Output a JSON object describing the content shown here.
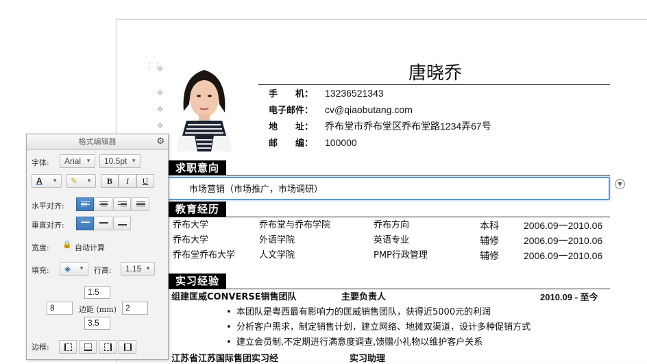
{
  "resume": {
    "name": "唐晓乔",
    "contact": [
      {
        "label": "手　　机：",
        "value": "13236521343"
      },
      {
        "label": "电子邮件：",
        "value": "cv@qiaobutang.com"
      },
      {
        "label": "地　　址：",
        "value": "乔布堂市乔布堂区乔布堂路1234弄67号"
      },
      {
        "label": "邮　　编：",
        "value": "100000"
      }
    ],
    "sections": {
      "intent": {
        "title": "求职意向",
        "text": "市场营销（市场推广，市场调研）"
      },
      "education": {
        "title": "教育经历",
        "rows": [
          [
            "乔布大学",
            "乔布堂与乔布学院",
            "乔布方向",
            "本科",
            "2006.09一2010.06"
          ],
          [
            "乔布大学",
            "外语学院",
            "英语专业",
            "辅修",
            "2006.09一2010.06"
          ],
          [
            "乔布堂乔布大学",
            "人文学院",
            "PMP行政管理",
            "辅修",
            "2006.09一2010.06"
          ]
        ]
      },
      "internship": {
        "title": "实习经验",
        "org": "组建匡威CONVERSE销售团队",
        "role": "主要负责人",
        "period": "2010.09 - 至今",
        "bullets": [
          "本团队是粤西最有影响力的匡威销售团队，获得近5000元的利润",
          "分析客户需求，制定销售计划，建立网络、地摊双渠道，设计多种促销方式",
          "建立会员制,不定期进行满意度调查,馈赠小礼物以维护客户关系"
        ],
        "next_row_partial": "江苏省江苏国际售团实习经　　　　　　　　实习助理"
      }
    }
  },
  "format_editor": {
    "title": "格式编辑器",
    "font_label": "字体:",
    "font_family": "Arial",
    "font_size": "10.5pt",
    "bold_label": "B",
    "italic_label": "I",
    "underline_label": "U",
    "font_color_label": "A",
    "halign_label": "水平对齐:",
    "valign_label": "垂直对齐:",
    "width_label": "宽度:",
    "width_value": "自动计算",
    "fill_label": "填充:",
    "line_height_label": "行高:",
    "line_height_value": "1.15",
    "margin_label": "边距 (mm)",
    "margin_top": "1.5",
    "margin_left": "8",
    "margin_right": "2",
    "margin_bottom": "3.5",
    "border_label": "边框:",
    "halign_selected": "left",
    "valign_selected": "top"
  },
  "colors": {
    "accent_blue": "#3e78b7",
    "focus_border": "#5b9bd5",
    "section_bg": "#000000"
  },
  "icons": {
    "gear": "⚙",
    "lock": "🔒",
    "move_handle": "✥",
    "drag_grip": "⋮⋮",
    "dropdown_circle": "▼"
  }
}
